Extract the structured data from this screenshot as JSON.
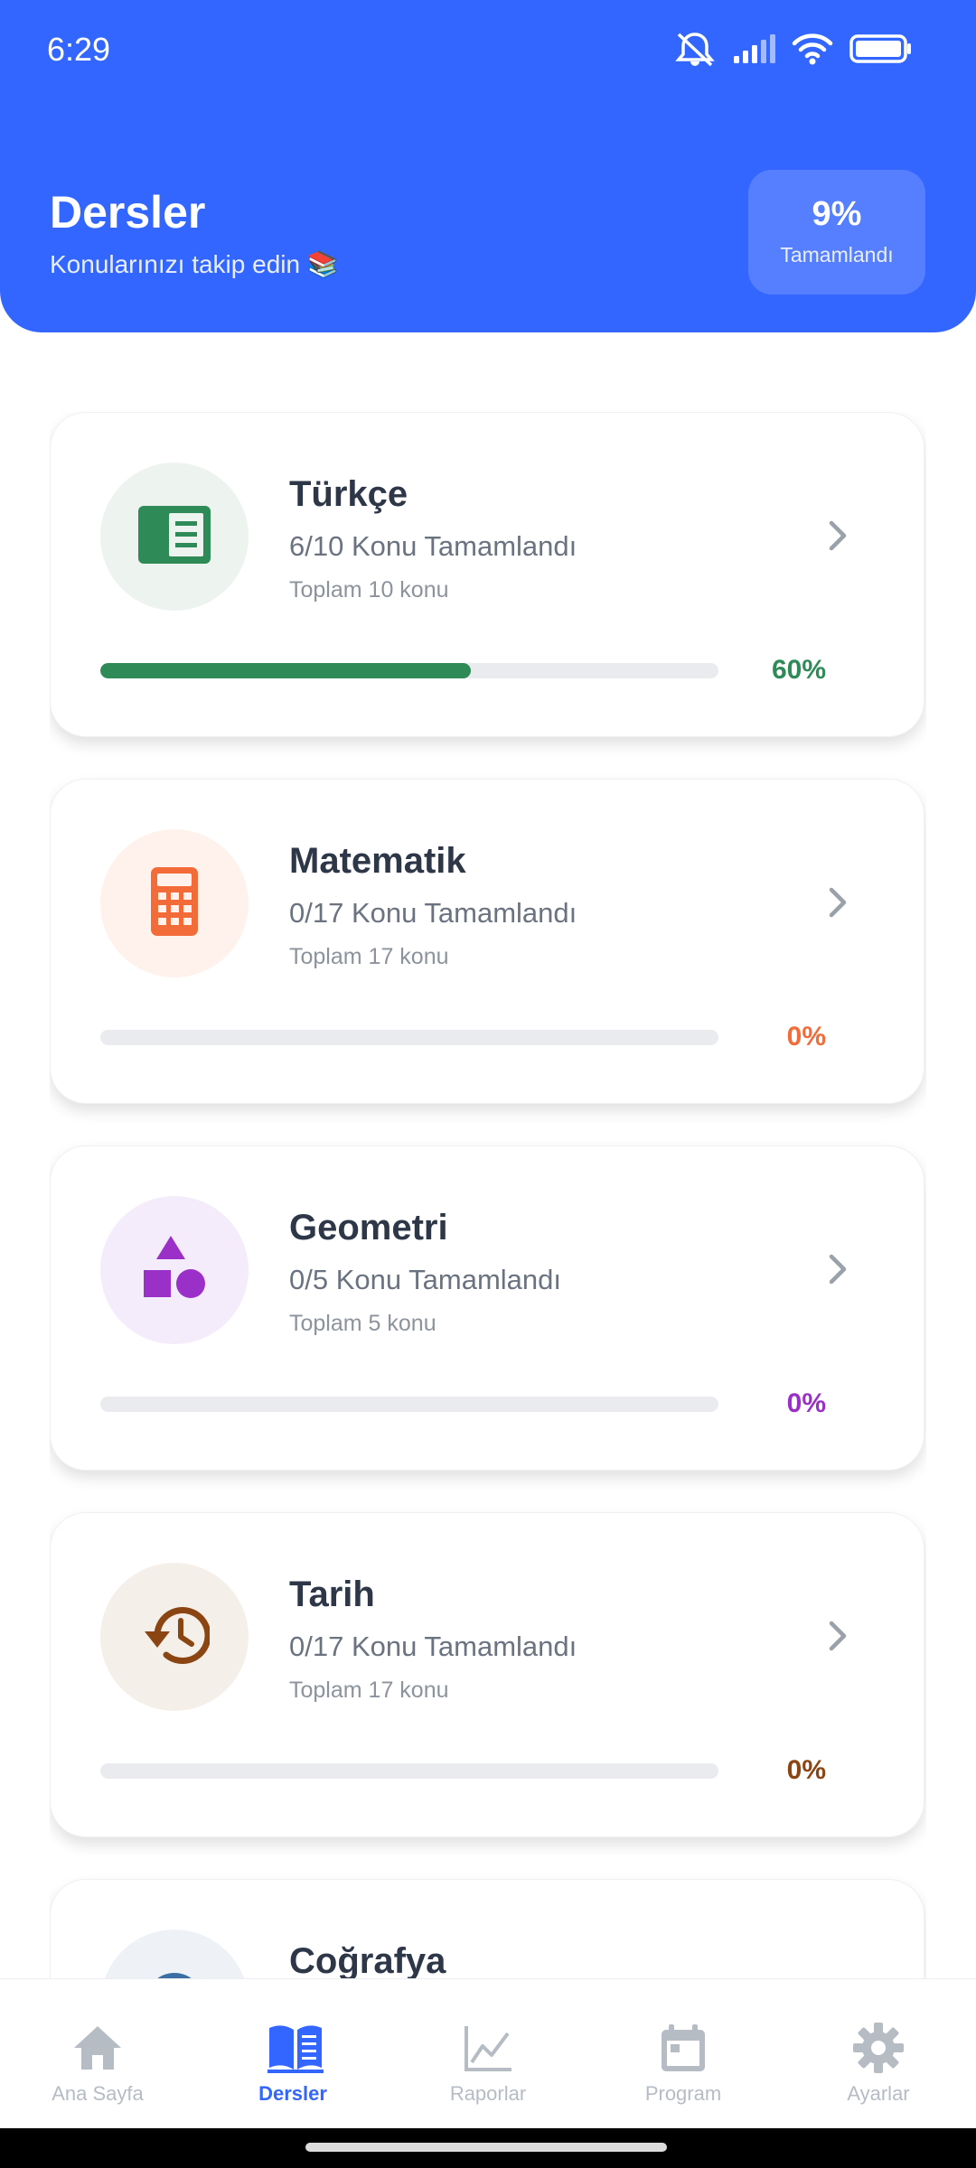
{
  "status": {
    "time": "6:29",
    "icons": [
      "mute-icon",
      "signal-icon",
      "wifi-icon",
      "battery-icon"
    ]
  },
  "header": {
    "title": "Dersler",
    "subtitle": "Konularınızı takip edin 📚",
    "progress": "9%",
    "progress_label": "Tamamlandı",
    "background": "#3366ff"
  },
  "courses": [
    {
      "name": "Türkçe",
      "done": "6/10 Konu Tamamlandı",
      "total": "Toplam 10 konu",
      "percent": "60%",
      "progress": 0.6,
      "color": "#2e8b57",
      "bg": "#edf4f0",
      "icon": "book-icon"
    },
    {
      "name": "Matematik",
      "done": "0/17 Konu Tamamlandı",
      "total": "Toplam 17 konu",
      "percent": "0%",
      "progress": 0,
      "color": "#f26b38",
      "bg": "#fff1eb",
      "icon": "calculator-icon"
    },
    {
      "name": "Geometri",
      "done": "0/5 Konu Tamamlandı",
      "total": "Toplam 5 konu",
      "percent": "0%",
      "progress": 0,
      "color": "#9b30c9",
      "bg": "#f4ecfa",
      "icon": "shapes-icon"
    },
    {
      "name": "Tarih",
      "done": "0/17 Konu Tamamlandı",
      "total": "Toplam 17 konu",
      "percent": "0%",
      "progress": 0,
      "color": "#8b4513",
      "bg": "#f5efea",
      "icon": "history-icon"
    },
    {
      "name": "Coğrafya",
      "done": "",
      "total": "",
      "percent": "",
      "progress": 0,
      "color": "#3a6ea5",
      "bg": "#eef2f7",
      "icon": "globe-icon"
    }
  ],
  "nav": [
    {
      "label": "Ana Sayfa",
      "icon": "home-icon",
      "active": false
    },
    {
      "label": "Dersler",
      "icon": "book-open-icon",
      "active": true
    },
    {
      "label": "Raporlar",
      "icon": "chart-icon",
      "active": false
    },
    {
      "label": "Program",
      "icon": "calendar-icon",
      "active": false
    },
    {
      "label": "Ayarlar",
      "icon": "gear-icon",
      "active": false
    }
  ]
}
